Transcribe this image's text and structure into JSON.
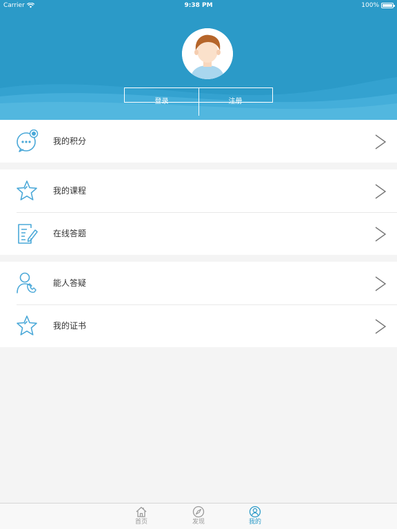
{
  "status_bar": {
    "carrier": "Carrier",
    "time": "9:38 PM",
    "battery": "100%"
  },
  "profile": {
    "login_label": "登录",
    "register_label": "注册"
  },
  "menu_groups": [
    [
      {
        "label": "我的积分",
        "icon": "chat-bubble-icon"
      }
    ],
    [
      {
        "label": "我的课程",
        "icon": "star-icon"
      },
      {
        "label": "在线答题",
        "icon": "edit-document-icon"
      }
    ],
    [
      {
        "label": "能人答疑",
        "icon": "support-person-icon"
      },
      {
        "label": "我的证书",
        "icon": "star-icon"
      }
    ]
  ],
  "tabbar": [
    {
      "label": "首页",
      "icon": "home-icon",
      "active": false
    },
    {
      "label": "发现",
      "icon": "compass-icon",
      "active": false
    },
    {
      "label": "我的",
      "icon": "user-icon",
      "active": true
    }
  ],
  "colors": {
    "accent": "#2b9ac8",
    "icon": "#4aa8d8",
    "background": "#f4f4f4"
  }
}
